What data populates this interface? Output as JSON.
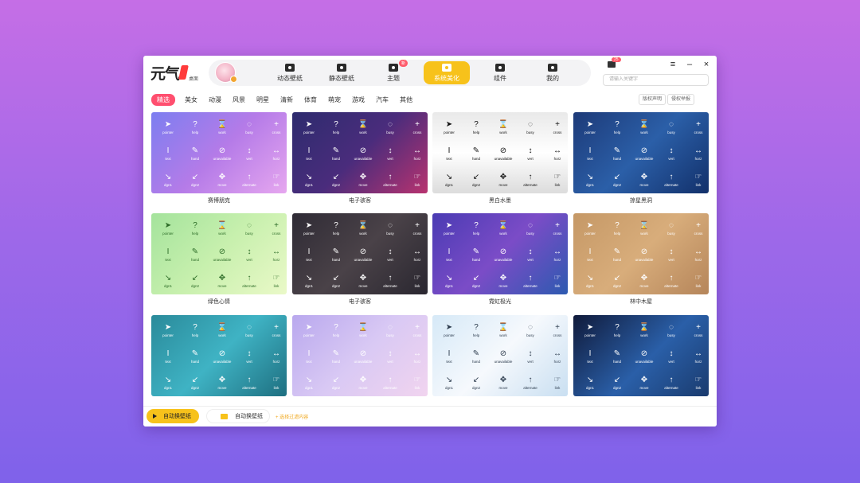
{
  "app": {
    "logo_text": "元气",
    "logo_sub": "桌面",
    "colors": {
      "accent": "#f7c21b",
      "pink": "#ff4f6f",
      "badge": "#ff5b6b"
    }
  },
  "nav": {
    "tabs": [
      {
        "label": "动态壁纸",
        "icon": "video-icon"
      },
      {
        "label": "静态壁纸",
        "icon": "image-icon"
      },
      {
        "label": "主题",
        "icon": "theme-icon",
        "badge": "新"
      },
      {
        "label": "系统美化",
        "icon": "beautify-icon",
        "active": true
      },
      {
        "label": "组件",
        "icon": "widget-icon"
      },
      {
        "label": "我的",
        "icon": "user-icon"
      }
    ],
    "mail_badge": "25"
  },
  "window_controls": {
    "menu": "≡",
    "minimize": "–",
    "close": "×"
  },
  "search": {
    "placeholder": "请输入关键字"
  },
  "categories": [
    "精选",
    "美女",
    "动漫",
    "风景",
    "明星",
    "清新",
    "体育",
    "萌宠",
    "游戏",
    "汽车",
    "其他"
  ],
  "right_buttons": [
    "版权声明",
    "侵权举报"
  ],
  "cursor_labels": [
    "pointer",
    "help",
    "work",
    "busy",
    "cross",
    "text",
    "hand",
    "unavailable",
    "vert",
    "horz",
    "dgn1",
    "dgn2",
    "move",
    "alternate",
    "link"
  ],
  "cards": [
    {
      "name": "赛博朋克",
      "bg": "linear-gradient(135deg,#7c7ef0 0%,#b57be8 50%,#e6a7ef 100%)",
      "fg": "#ffffff"
    },
    {
      "name": "电子骇客",
      "bg": "linear-gradient(135deg,#2d2b6e 0%,#4a2c7c 50%,#b8336f 100%)",
      "fg": "#ffffff"
    },
    {
      "name": "黑白水墨",
      "bg": "linear-gradient(180deg,#e9e9e9 0%,#ffffff 50%,#dcdcdc 100%)",
      "fg": "#111111"
    },
    {
      "name": "掠星黑洞",
      "bg": "linear-gradient(135deg,#1d3a78 0%,#2b5fa8 50%,#12306a 100%)",
      "fg": "#ffffff"
    },
    {
      "name": "绿色心情",
      "bg": "linear-gradient(135deg,#a4e39c 0%,#c8f0ae 50%,#eaf9c8 100%)",
      "fg": "#2c6b27"
    },
    {
      "name": "电子骇客",
      "bg": "linear-gradient(135deg,#2f2b35 0%,#4a4248 50%,#2a2730 100%)",
      "fg": "#ffffff"
    },
    {
      "name": "霓虹极光",
      "bg": "linear-gradient(135deg,#4a3bb3 0%,#7b4cc7 50%,#2d5ab0 100%)",
      "fg": "#ffffff"
    },
    {
      "name": "林中木屋",
      "bg": "linear-gradient(135deg,#c59866 0%,#d8ad7b 50%,#b5855a 100%)",
      "fg": "#ffffff"
    },
    {
      "name": "",
      "bg": "linear-gradient(135deg,#2a8a9a 0%,#3fb3c4 50%,#1e6f80 100%)",
      "fg": "#ffffff"
    },
    {
      "name": "",
      "bg": "linear-gradient(135deg,#b9a8ee 0%,#d9c9f4 50%,#f1d4ef 100%)",
      "fg": "#ffffff"
    },
    {
      "name": "",
      "bg": "linear-gradient(135deg,#d6e9f7 0%,#f6f9fd 50%,#c9dff1 100%)",
      "fg": "#2c3b4d"
    },
    {
      "name": "",
      "bg": "linear-gradient(135deg,#101a3a 0%,#2a5fa8 55%,#1a3b6e 100%)",
      "fg": "#ffffff"
    }
  ],
  "bottom": {
    "auto_label_1": "自动换壁纸",
    "auto_label_2": "自动换壁纸",
    "select_link": "+ 选择过滤内容"
  }
}
